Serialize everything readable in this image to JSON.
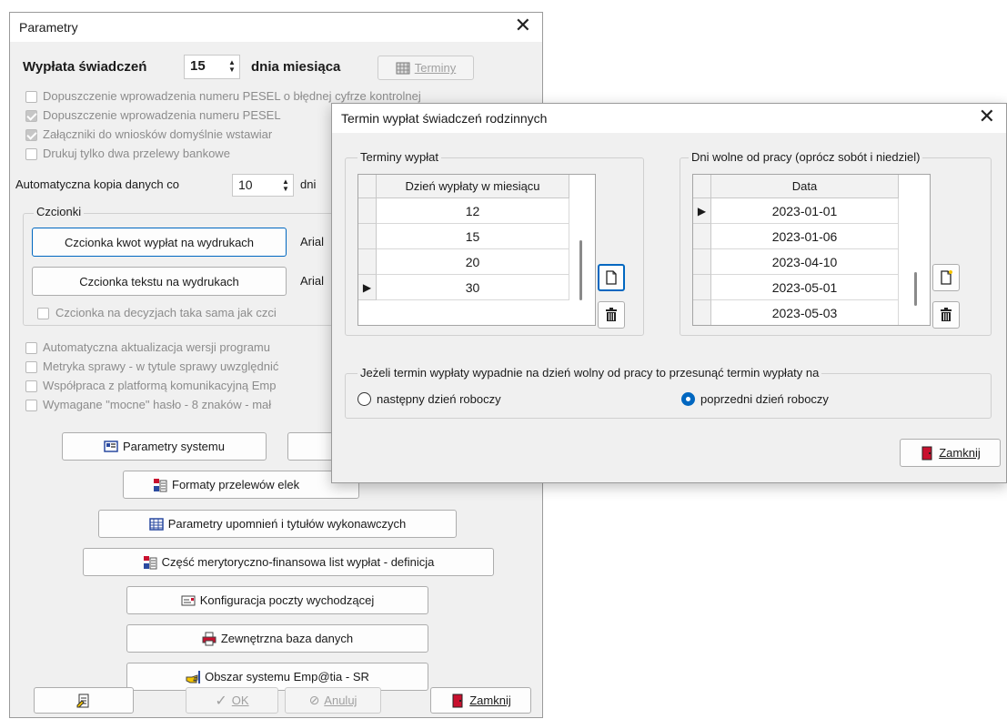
{
  "main": {
    "title": "Parametry",
    "payout_prefix": "Wypłata świadczeń",
    "payout_day": "15",
    "payout_suffix": "dnia miesiąca",
    "terms_button": "Terminy",
    "checks": [
      {
        "label": "Dopuszczenie wprowadzenia numeru PESEL o błędnej cyfrze kontrolnej",
        "checked": false
      },
      {
        "label": "Dopuszczenie wprowadzenia numeru PESEL",
        "checked": true
      },
      {
        "label": "Załączniki do wniosków domyślnie wstawiar",
        "checked": true
      },
      {
        "label": "Drukuj tylko dwa przelewy bankowe",
        "checked": false
      }
    ],
    "backup_prefix": "Automatyczna kopia danych co",
    "backup_value": "10",
    "backup_suffix": "dni",
    "fonts_group": "Czcionki",
    "font_amount_button": "Czcionka kwot wypłat na wydrukach",
    "font_amount_value": "Arial",
    "font_text_button": "Czcionka tekstu na wydrukach",
    "font_text_value": "Arial",
    "font_same_check": "Czcionka na decyzjach taka sama jak czci",
    "checks2": [
      "Automatyczna aktualizacja wersji programu",
      "Metryka sprawy - w tytule sprawy uwzględnić",
      "Współpraca z platformą komunikacyjną Emp",
      "Wymagane \"mocne\" hasło - 8 znaków - mał"
    ],
    "btn_system": "Parametry systemu",
    "btn_transfers": "Formaty przelewów elek",
    "btn_reminders": "Parametry upomnień i tytułów wykonawczych",
    "btn_lists": "Część merytoryczno-finansowa list wypłat - definicja",
    "btn_mail": "Konfiguracja poczty wychodzącej",
    "btn_extdb": "Zewnętrzna baza danych",
    "btn_area": "Obszar systemu Emp@tia - SR",
    "btn_ok": "OK",
    "btn_cancel": "Anuluj",
    "btn_close": "Zamknij"
  },
  "dialog": {
    "title": "Termin wypłat świadczeń rodzinnych",
    "terms_group": "Terminy wypłat",
    "terms_header": "Dzień wypłaty w miesiącu",
    "terms": [
      "12",
      "15",
      "20",
      "30"
    ],
    "holidays_group": "Dni wolne od pracy (oprócz sobót i niedziel)",
    "holidays_header": "Data",
    "holidays": [
      "2023-01-01",
      "2023-01-06",
      "2023-04-10",
      "2023-05-01",
      "2023-05-03"
    ],
    "shift_group": "Jeżeli termin wypłaty wypadnie na dzień wolny od pracy to przesunąć termin wypłaty na",
    "radio_next": "następny dzień roboczy",
    "radio_prev": "poprzedni dzień roboczy",
    "selected": "prev",
    "close": "Zamknij"
  },
  "colors": {
    "accent": "#0067c0",
    "door": "#c8102e"
  }
}
